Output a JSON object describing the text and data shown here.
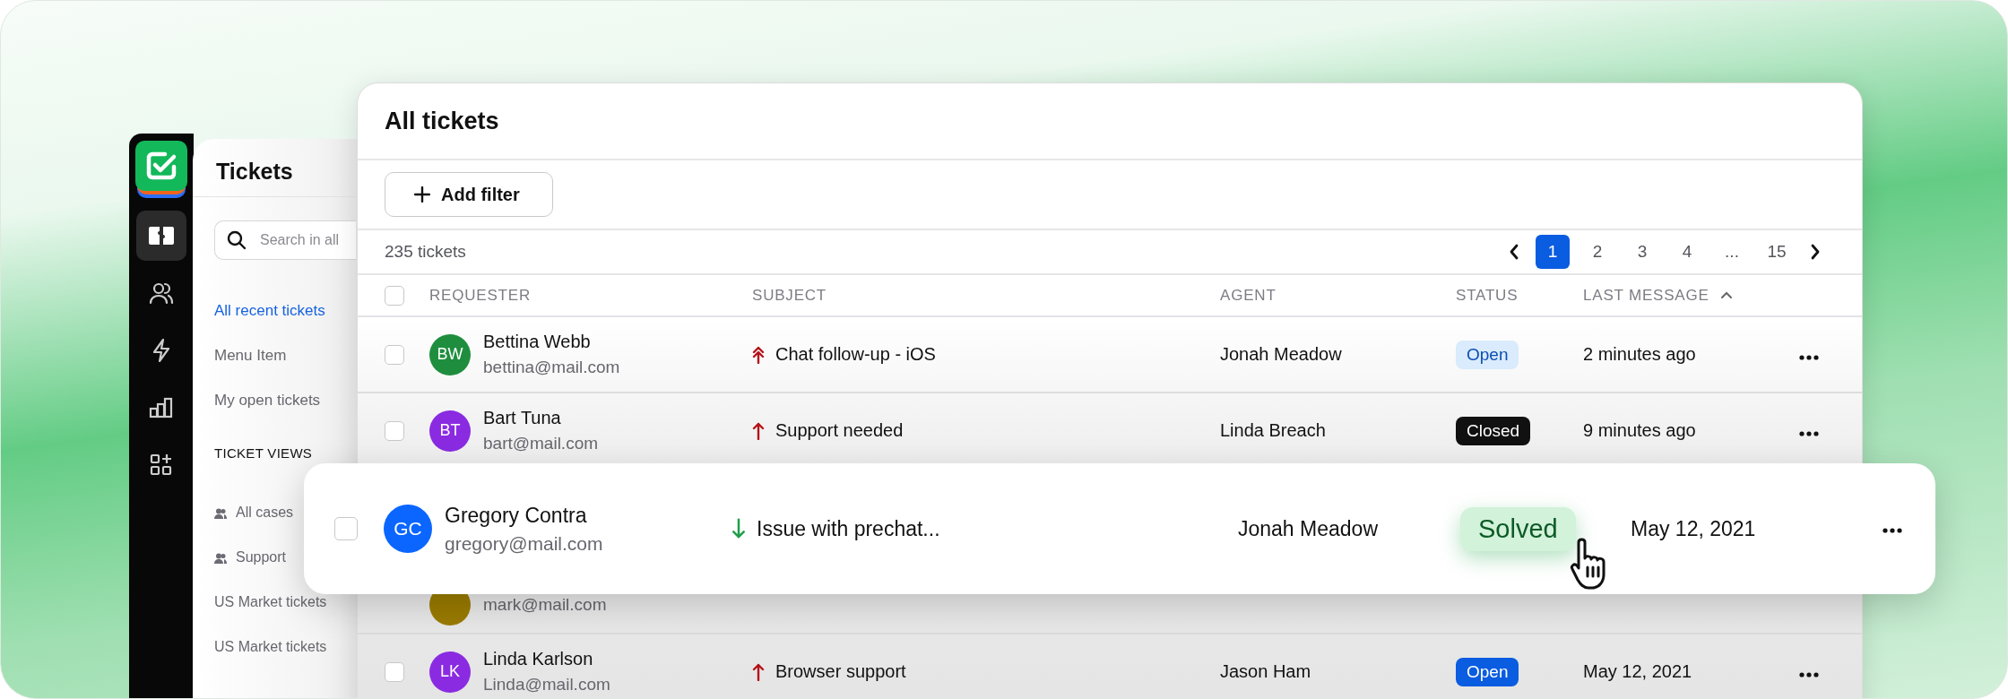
{
  "nav": {
    "items": [
      {
        "kind": "tickets",
        "selected": true
      },
      {
        "kind": "users",
        "selected": false
      },
      {
        "kind": "bolt",
        "selected": false
      },
      {
        "kind": "chart",
        "selected": false
      },
      {
        "kind": "apps",
        "selected": false
      }
    ]
  },
  "panel": {
    "title": "Tickets",
    "search": {
      "placeholder": "Search in all"
    },
    "menu": [
      {
        "label": "All recent tickets",
        "selected": true
      },
      {
        "label": "Menu Item",
        "selected": false
      },
      {
        "label": "My open tickets",
        "selected": false
      }
    ],
    "section": "TICKET VIEWS",
    "views": [
      {
        "label": "All cases",
        "kind": "group"
      },
      {
        "label": "Support",
        "kind": "group"
      },
      {
        "label": "US Market tickets",
        "kind": "plain"
      },
      {
        "label": "US Market tickets",
        "kind": "plain"
      }
    ]
  },
  "main": {
    "title": "All tickets",
    "add_filter": "Add filter",
    "count": "235 tickets",
    "pagination": [
      {
        "label": "1",
        "selected": true
      },
      {
        "label": "2",
        "selected": false
      },
      {
        "label": "3",
        "selected": false
      },
      {
        "label": "4",
        "selected": false
      },
      {
        "label": "...",
        "selected": false
      },
      {
        "label": "15",
        "selected": false
      }
    ],
    "select_all": {
      "checked": false
    },
    "columns": [
      "REQUESTER",
      "SUBJECT",
      "AGENT",
      "STATUS",
      "LAST MESSAGE"
    ],
    "rows": [
      {
        "checked": false,
        "initials": "BW",
        "color": "#1e8e3e",
        "name": "Bettina Webb",
        "email": "bettina@mail.com",
        "kind": "urgent",
        "subject": "Chat follow-up - iOS",
        "agent": "Jonah Meadow",
        "status": {
          "label": "Open",
          "kind": "soft"
        },
        "last": "2 minutes ago"
      },
      {
        "checked": false,
        "initials": "BT",
        "color": "#8a2be2",
        "name": "Bart Tuna",
        "email": "bart@mail.com",
        "kind": "high",
        "subject": "Support needed",
        "agent": "Linda Breach",
        "status": {
          "label": "Closed",
          "kind": "dark"
        },
        "last": "9 minutes ago"
      },
      {
        "color": "#9a7b00",
        "email": "mark@mail.com"
      },
      {
        "checked": false,
        "initials": "LK",
        "color": "#8a2be2",
        "name": "Linda Karlson",
        "email": "Linda@mail.com",
        "kind": "high",
        "subject": "Browser support",
        "agent": "Jason Ham",
        "status": {
          "label": "Open",
          "kind": "solid"
        },
        "last": "May 12, 2021"
      }
    ]
  },
  "highlight": {
    "checked": false,
    "initials": "GC",
    "color": "#0a66ff",
    "name": "Gregory Contra",
    "email": "gregory@mail.com",
    "kind": "low",
    "subject": "Issue with prechat...",
    "agent": "Jonah Meadow",
    "status": {
      "label": "Solved",
      "kind": "success"
    },
    "last": "May 12, 2021"
  }
}
